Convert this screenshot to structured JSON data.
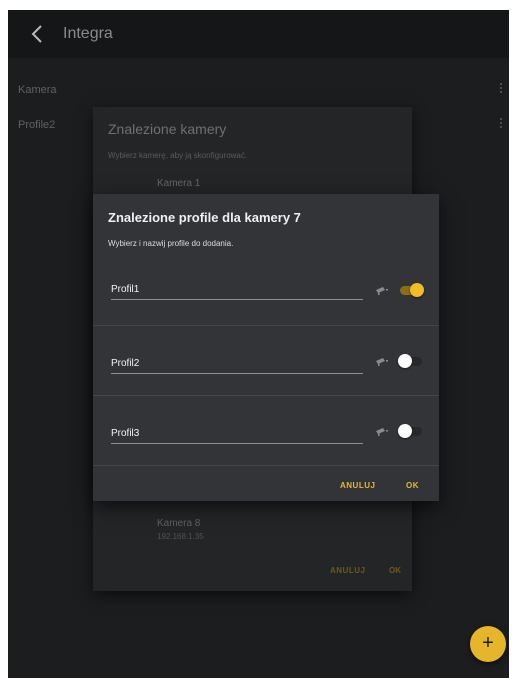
{
  "appbar": {
    "title": "Integra"
  },
  "list": {
    "items": [
      {
        "label": "Kamera"
      },
      {
        "label": "Profile2"
      }
    ]
  },
  "camera_dialog": {
    "title": "Znalezione kamery",
    "subtitle": "Wybierz kamerę, aby ją skonfigurować.",
    "items": [
      {
        "name": "Kamera 1"
      },
      {
        "name": "Kamera 8",
        "ip": "192.168.1.35"
      }
    ],
    "cancel_label": "ANULUJ",
    "ok_label": "OK"
  },
  "profile_dialog": {
    "title": "Znalezione profile dla kamery 7",
    "subtitle": "Wybierz i nazwij profile do dodania.",
    "profiles": [
      {
        "name": "Profil1",
        "enabled": true
      },
      {
        "name": "Profil2",
        "enabled": false
      },
      {
        "name": "Profil3",
        "enabled": false
      }
    ],
    "cancel_label": "ANULUJ",
    "ok_label": "OK"
  },
  "fab": {
    "label": "+"
  },
  "colors": {
    "accent": "#e8b92a",
    "background": "#1c1d1f",
    "dialog": "#333437"
  },
  "icons": [
    "chevron-left-icon",
    "more-vert-icon",
    "camera-icon",
    "plus-icon"
  ]
}
